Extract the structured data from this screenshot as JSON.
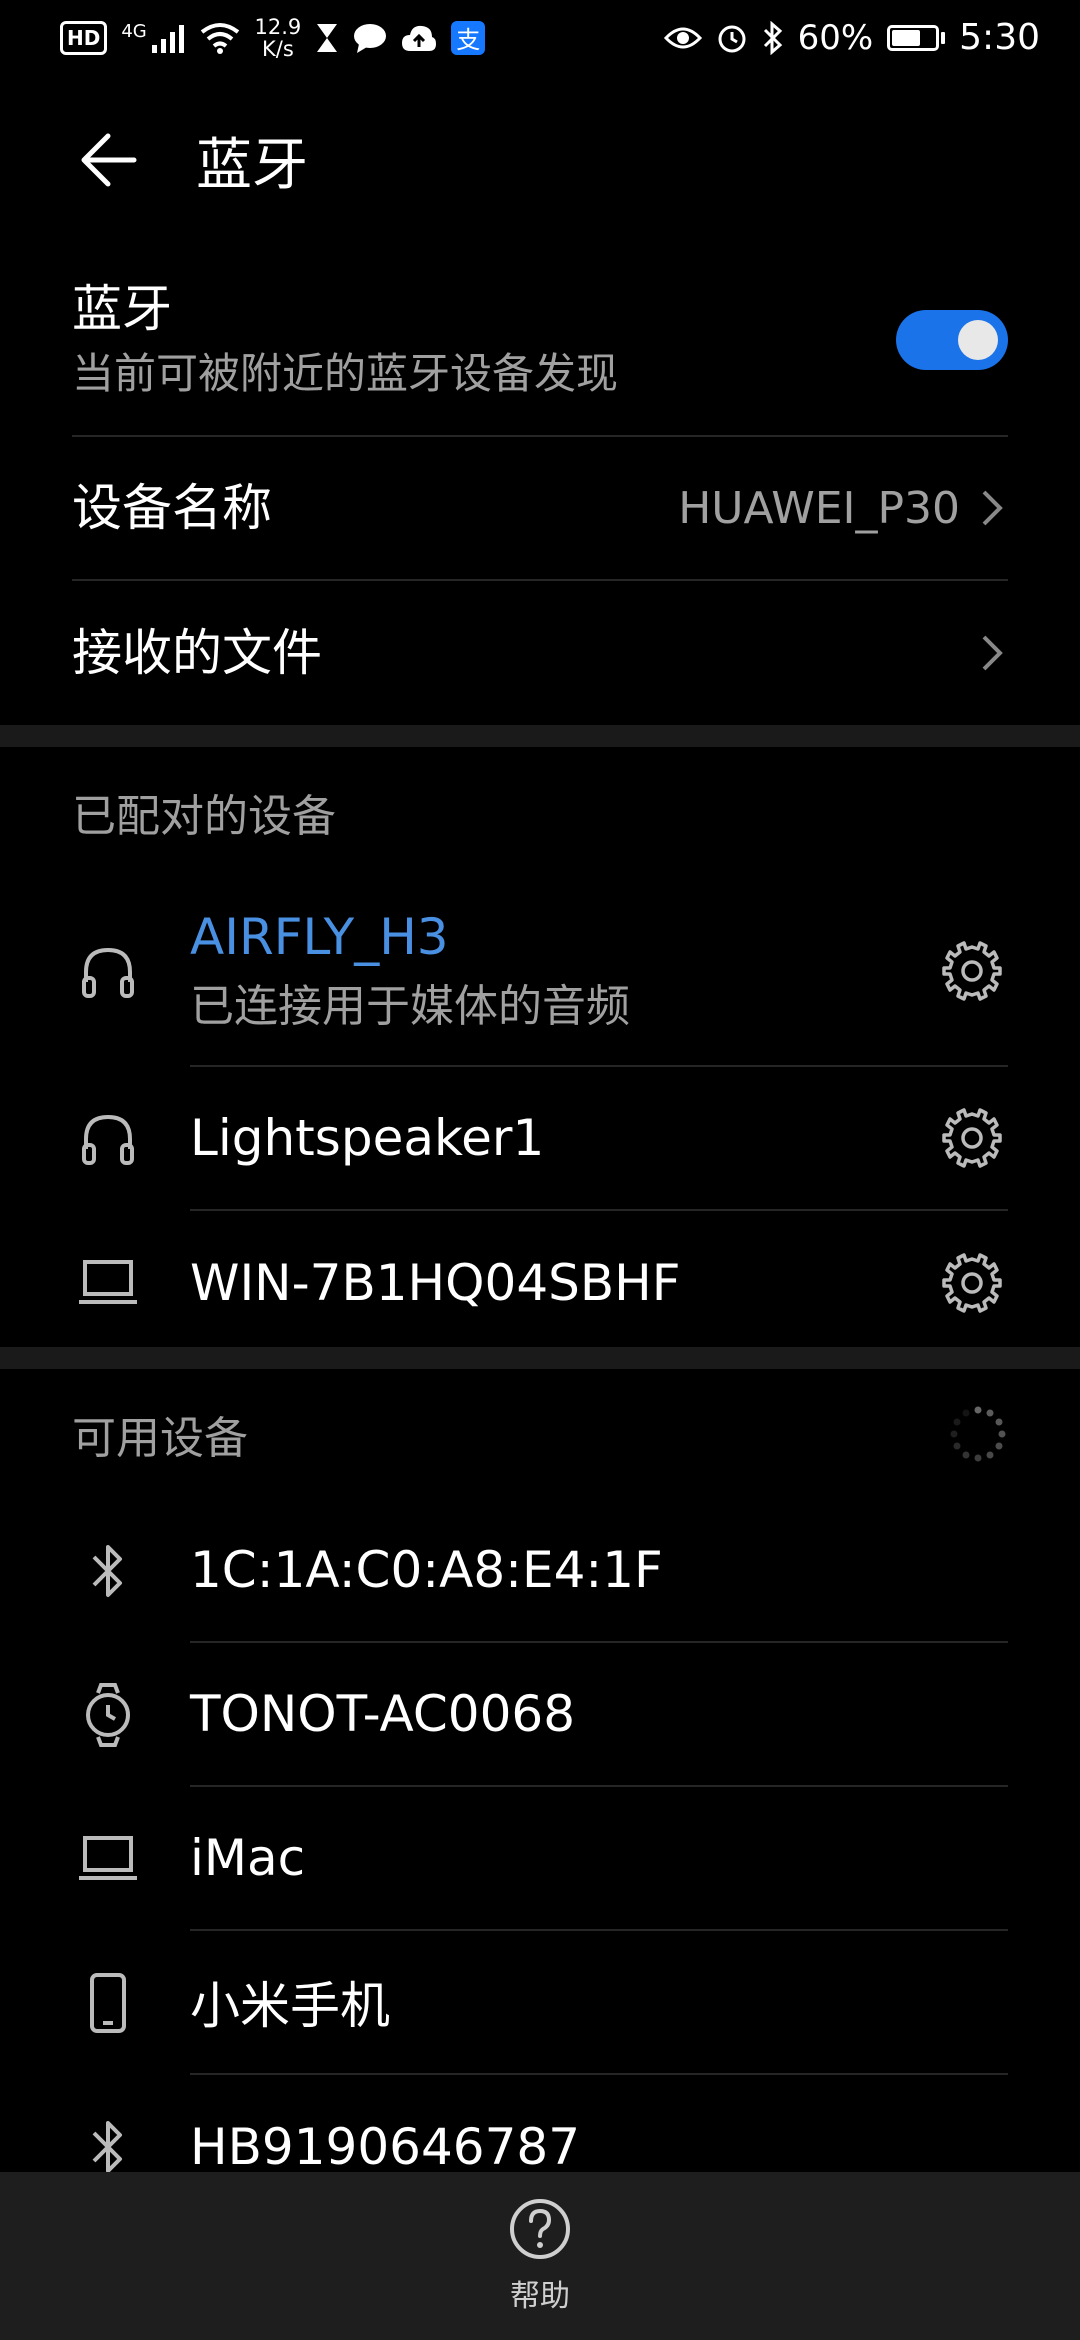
{
  "status_bar": {
    "hd": "HD",
    "net": "4G",
    "speed_value": "12.9",
    "speed_unit": "K/s",
    "battery": "60%",
    "time": "5:30",
    "alipay": "支"
  },
  "header": {
    "title": "蓝牙"
  },
  "bluetooth": {
    "title": "蓝牙",
    "subtitle": "当前可被附近的蓝牙设备发现",
    "enabled": true
  },
  "device_name": {
    "label": "设备名称",
    "value": "HUAWEI_P30"
  },
  "received_files": {
    "label": "接收的文件"
  },
  "paired": {
    "header": "已配对的设备",
    "devices": [
      {
        "name": "AIRFLY_H3",
        "status": "已连接用于媒体的音频",
        "icon": "headphones-icon"
      },
      {
        "name": "Lightspeaker1",
        "icon": "headphones-icon"
      },
      {
        "name": "WIN-7B1HQ04SBHF",
        "icon": "laptop-icon"
      }
    ]
  },
  "available": {
    "header": "可用设备",
    "devices": [
      {
        "name": "1C:1A:C0:A8:E4:1F",
        "icon": "bluetooth-icon"
      },
      {
        "name": "TONOT-AC0068",
        "icon": "watch-icon"
      },
      {
        "name": "iMac",
        "icon": "laptop-icon"
      },
      {
        "name": "小米手机",
        "icon": "phone-icon"
      },
      {
        "name": "HB9190646787",
        "icon": "bluetooth-icon"
      }
    ]
  },
  "bottom": {
    "help_label": "帮助"
  },
  "colors": {
    "accent": "#1a73e8",
    "active_device": "#4a90e2",
    "background": "#000000"
  }
}
